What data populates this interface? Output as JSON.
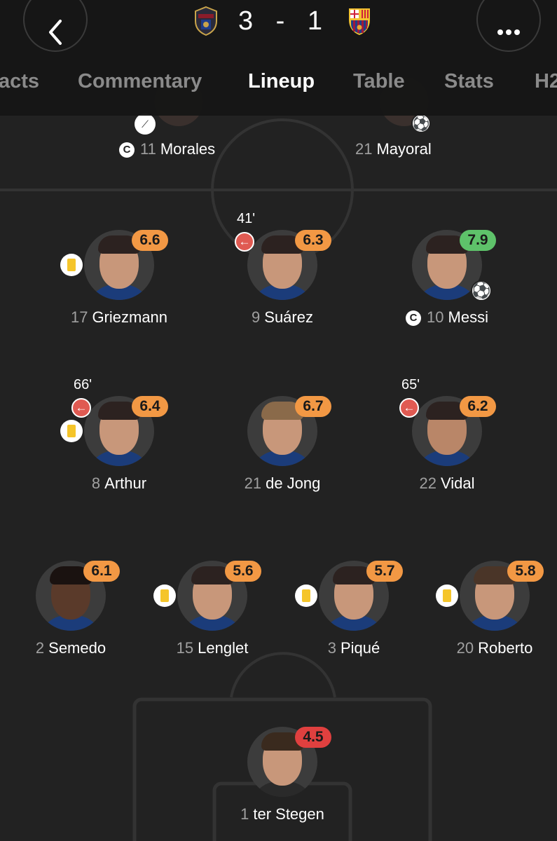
{
  "header": {
    "score_home": "3",
    "score_sep": "-",
    "score_away": "1",
    "back_icon": "chevron-left-icon",
    "more_icon": "ellipsis-icon"
  },
  "tabs": [
    "acts",
    "Commentary",
    "Lineup",
    "Table",
    "Stats",
    "H2"
  ],
  "active_tab": "Lineup",
  "opponents_top": [
    {
      "number": "11",
      "name": "Morales",
      "captain": "C"
    },
    {
      "number": "21",
      "name": "Mayoral"
    }
  ],
  "players": [
    {
      "number": "17",
      "name": "Griezmann",
      "rating": "6.6",
      "rating_color": "#f29844"
    },
    {
      "number": "9",
      "name": "Suárez",
      "rating": "6.3",
      "sub_minute": "41'",
      "rating_color": "#f29844"
    },
    {
      "number": "10",
      "name": "Messi",
      "rating": "7.9",
      "captain": "C",
      "rating_color": "#5ec26a"
    },
    {
      "number": "8",
      "name": "Arthur",
      "rating": "6.4",
      "sub_minute": "66'",
      "rating_color": "#f29844"
    },
    {
      "number": "21",
      "name": "de Jong",
      "rating": "6.7",
      "rating_color": "#f29844"
    },
    {
      "number": "22",
      "name": "Vidal",
      "rating": "6.2",
      "sub_minute": "65'",
      "rating_color": "#f29844"
    },
    {
      "number": "2",
      "name": "Semedo",
      "rating": "6.1",
      "rating_color": "#f29844"
    },
    {
      "number": "15",
      "name": "Lenglet",
      "rating": "5.6",
      "rating_color": "#f29844"
    },
    {
      "number": "3",
      "name": "Piqué",
      "rating": "5.7",
      "rating_color": "#f29844"
    },
    {
      "number": "20",
      "name": "Roberto",
      "rating": "5.8",
      "rating_color": "#f29844"
    },
    {
      "number": "1",
      "name": "ter Stegen",
      "rating": "4.5",
      "rating_color": "#e0403f"
    }
  ]
}
